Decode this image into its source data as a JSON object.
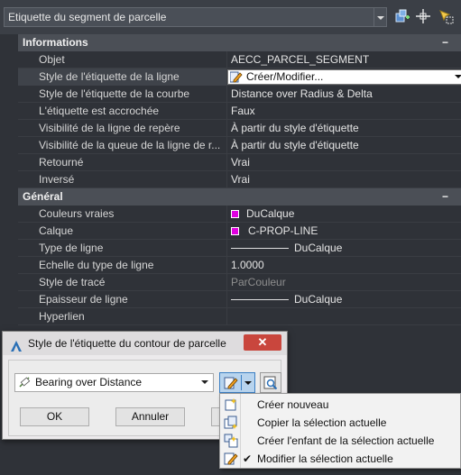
{
  "header": {
    "selector_value": "Etiquette du segment de parcelle",
    "tools": [
      "add-selection-icon",
      "pick-object-icon",
      "quick-select-icon"
    ]
  },
  "sections": [
    {
      "title": "Informations",
      "toggle": "−",
      "rows": [
        {
          "name": "Objet",
          "value": "AECC_PARCEL_SEGMENT"
        },
        {
          "name": "Style de l'étiquette de la ligne",
          "value": "Créer/Modifier..."
        },
        {
          "name": "Style de l'étiquette de la courbe",
          "value": "Distance over Radius & Delta"
        },
        {
          "name": "L'étiquette est accrochée",
          "value": "Faux"
        },
        {
          "name": "Visibilité de la ligne de repère",
          "value": "À partir du style d'étiquette"
        },
        {
          "name": "Visibilité de la queue de la ligne de r...",
          "value": "À partir du style d'étiquette"
        },
        {
          "name": "Retourné",
          "value": "Vrai"
        },
        {
          "name": "Inversé",
          "value": "Vrai"
        }
      ]
    },
    {
      "title": "Général",
      "toggle": "−",
      "rows": [
        {
          "name": "Couleurs vraies",
          "value": "DuCalque"
        },
        {
          "name": "Calque",
          "value": "C-PROP-LINE"
        },
        {
          "name": "Type de ligne",
          "value": "DuCalque"
        },
        {
          "name": "Echelle du type de ligne",
          "value": "1.0000"
        },
        {
          "name": "Style de tracé",
          "value": "ParCouleur"
        },
        {
          "name": "Epaisseur de ligne",
          "value": "DuCalque"
        },
        {
          "name": "Hyperlien",
          "value": ""
        }
      ]
    }
  ],
  "colors": {
    "swatch": "#e000e0",
    "accent": "#3b7fc4",
    "close": "#c9463d"
  },
  "dialog": {
    "title": "Style de l'étiquette du contour de parcelle",
    "close": "✕",
    "style_value": "Bearing over Distance",
    "ok": "OK",
    "cancel": "Annuler"
  },
  "menu": {
    "items": [
      {
        "label": "Créer nouveau",
        "icon": "create-style-icon"
      },
      {
        "label": "Copier la sélection actuelle",
        "icon": "copy-style-icon"
      },
      {
        "label": "Créer l'enfant de la sélection actuelle",
        "icon": "child-style-icon"
      },
      {
        "label": "Modifier la sélection actuelle",
        "icon": "edit-style-icon",
        "checked": "✔"
      }
    ]
  }
}
